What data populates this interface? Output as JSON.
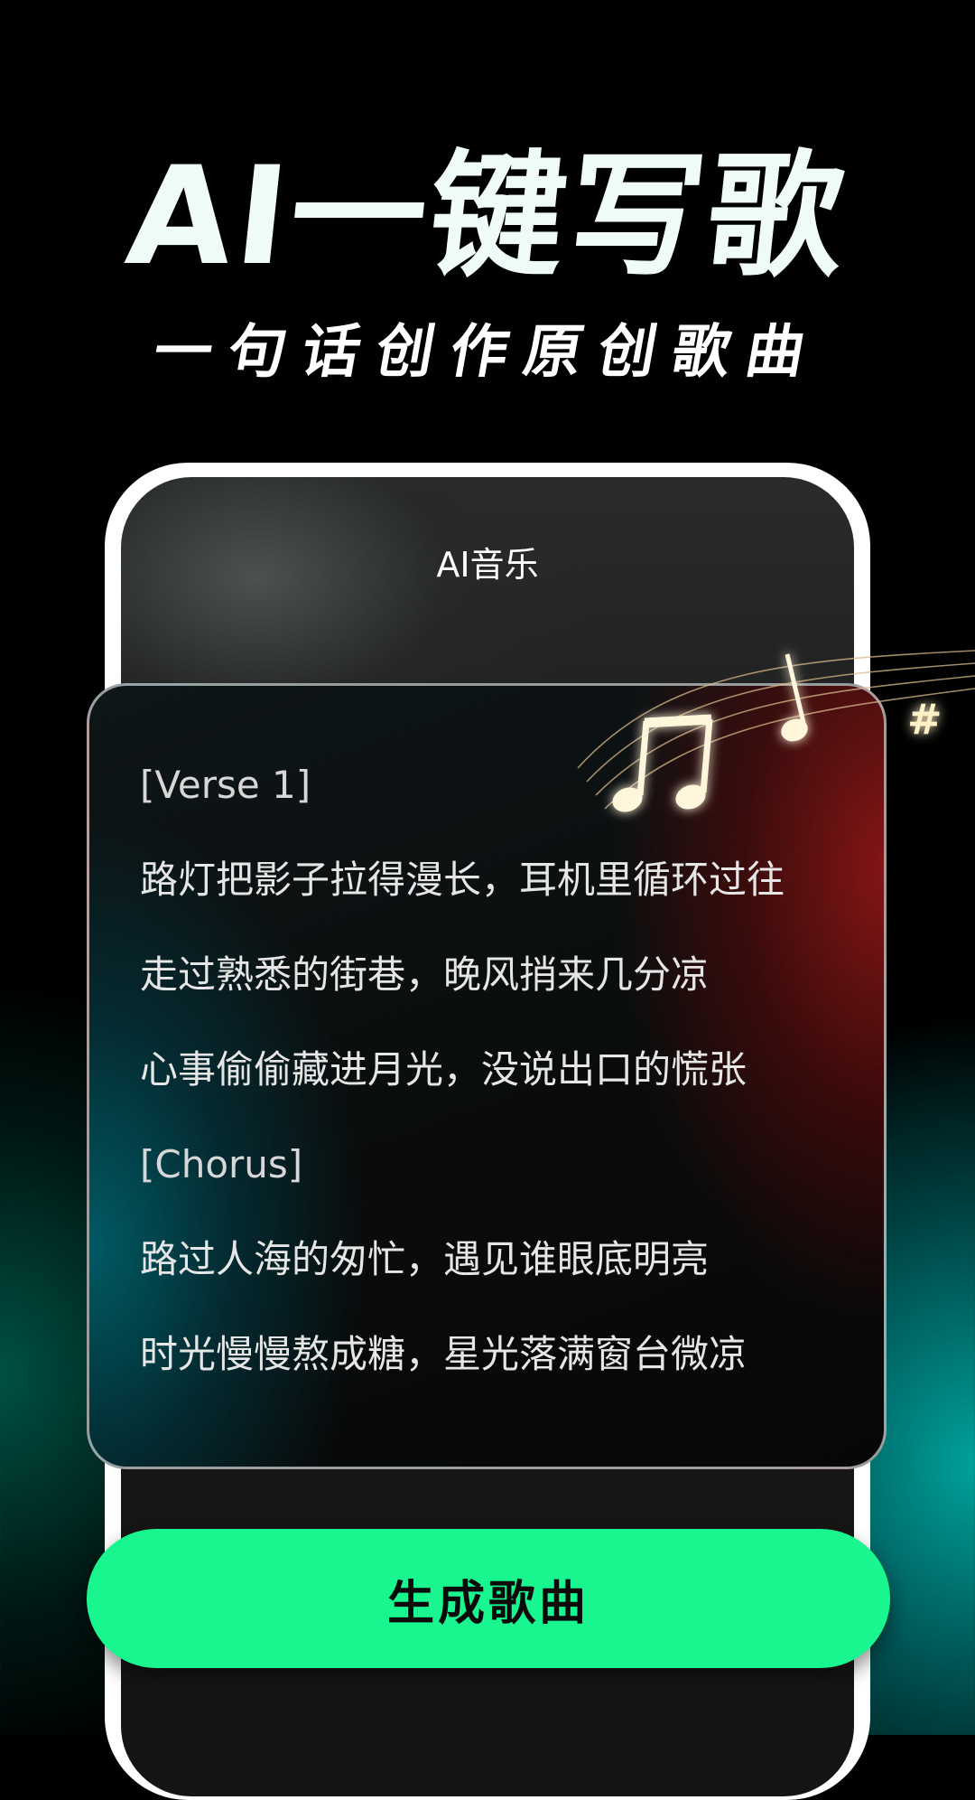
{
  "hero": {
    "title": "AI一键写歌",
    "subtitle": "一句话创作原创歌曲"
  },
  "app": {
    "title": "AI音乐"
  },
  "lyrics": [
    "[Verse 1]",
    "路灯把影子拉得漫长，耳机里循环过往",
    "走过熟悉的街巷，晚风捎来几分凉",
    "心事偷偷藏进月光，没说出口的慌张",
    "[Chorus]",
    "路过人海的匆忙，遇见谁眼底明亮",
    "时光慢慢熬成糖，星光落满窗台微凉"
  ],
  "decor": {
    "sharp_symbol": "#"
  },
  "actions": {
    "generate_label": "生成歌曲"
  },
  "colors": {
    "accent": "#19f68f",
    "background": "#000000",
    "teal_glow": "#00aaa5",
    "red_glow": "#8c1616"
  }
}
